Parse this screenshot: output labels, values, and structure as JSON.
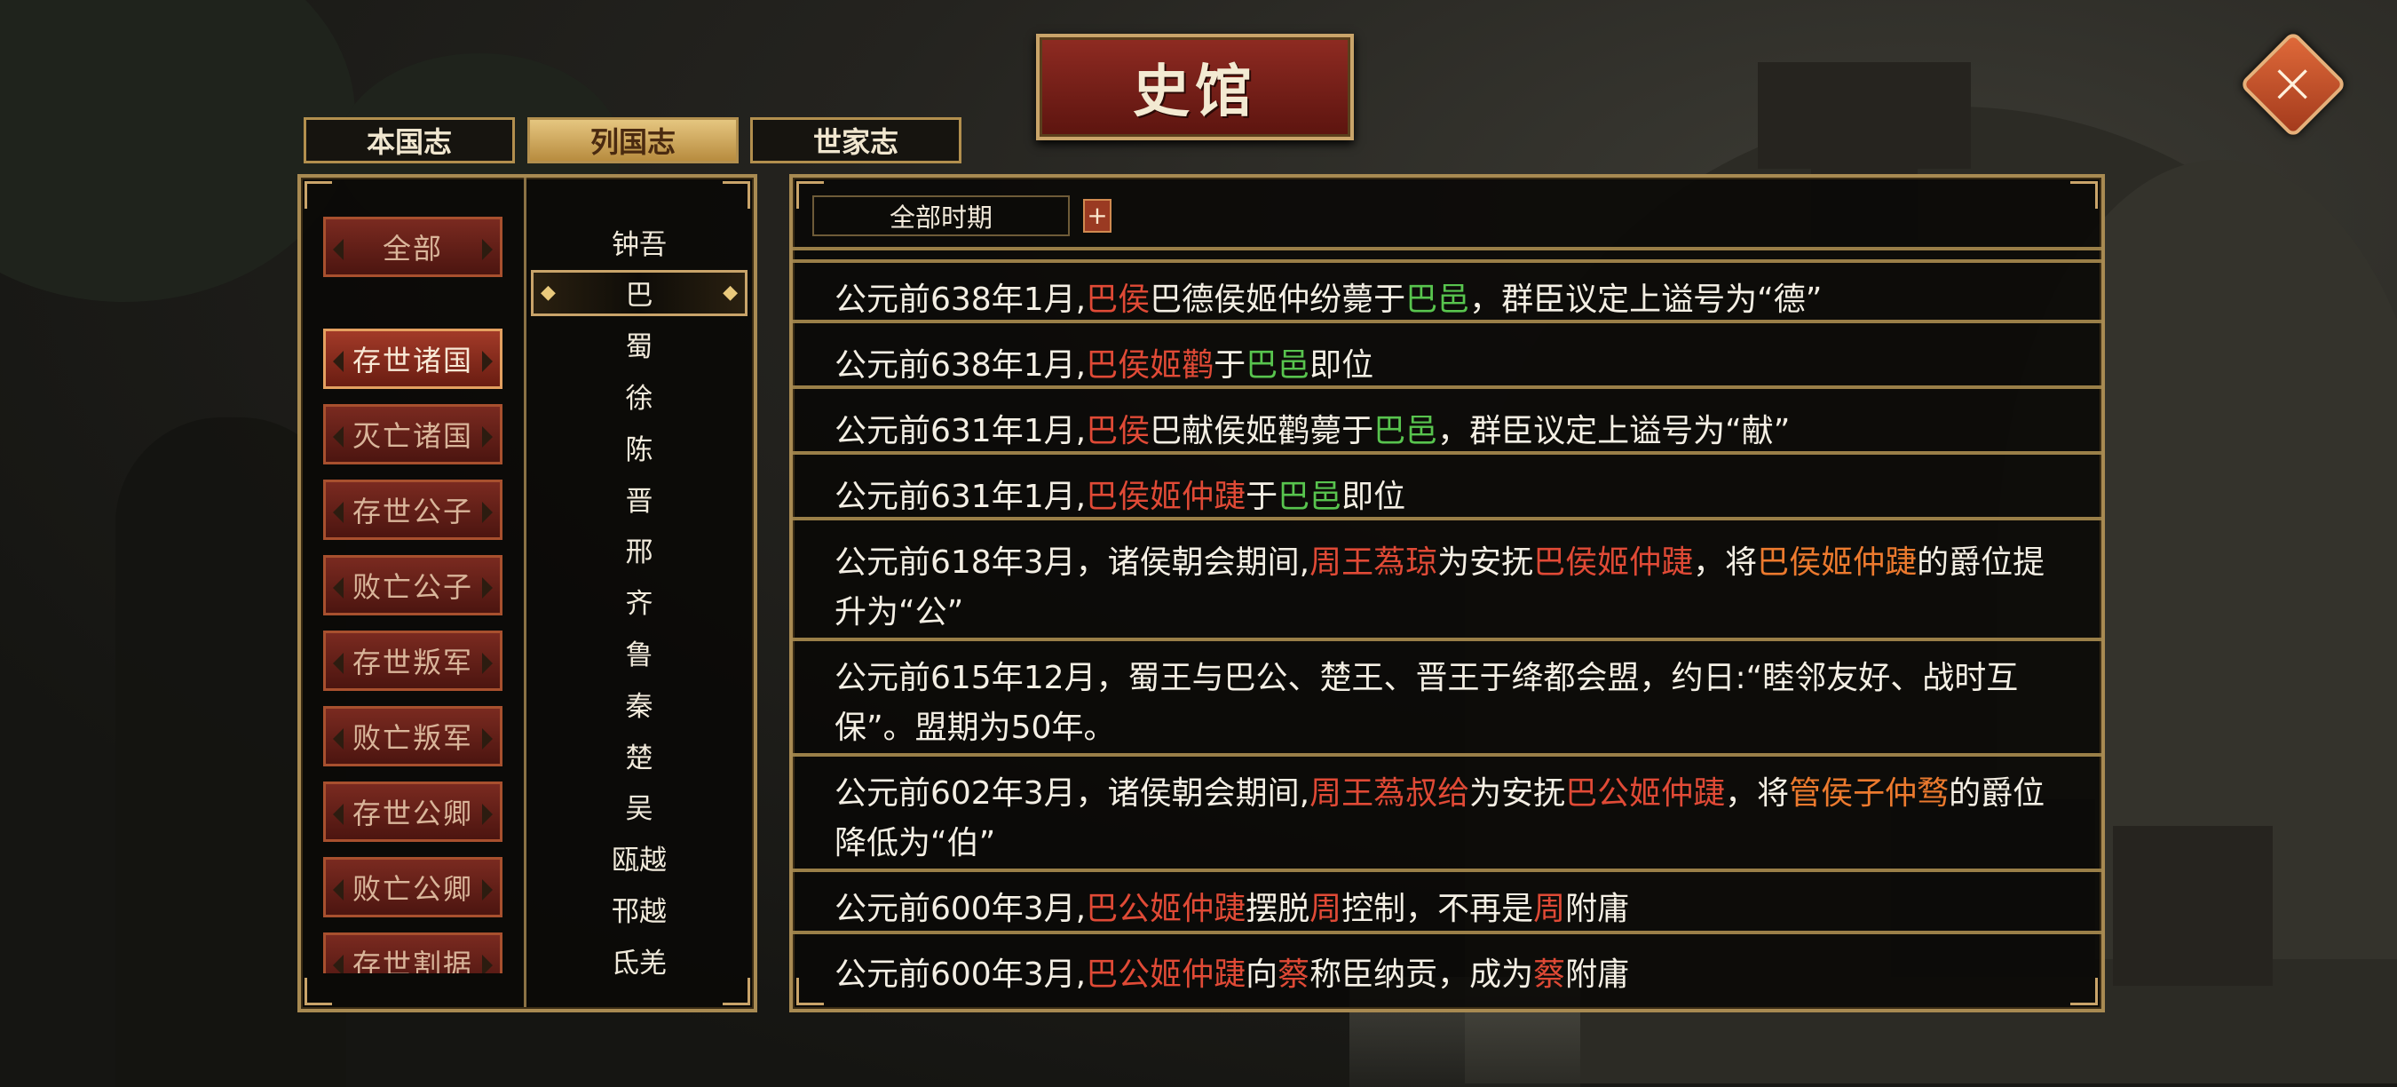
{
  "window": {
    "title": "史馆",
    "close_icon": "close-icon"
  },
  "tabs": [
    {
      "label": "本国志",
      "active": false
    },
    {
      "label": "列国志",
      "active": true
    },
    {
      "label": "世家志",
      "active": false
    }
  ],
  "categories": {
    "all_label": "全部",
    "items": [
      {
        "label": "存世诸国",
        "active": true
      },
      {
        "label": "灭亡诸国",
        "active": false
      },
      {
        "label": "存世公子",
        "active": false
      },
      {
        "label": "败亡公子",
        "active": false
      },
      {
        "label": "存世叛军",
        "active": false
      },
      {
        "label": "败亡叛军",
        "active": false
      },
      {
        "label": "存世公卿",
        "active": false
      },
      {
        "label": "败亡公卿",
        "active": false
      },
      {
        "label": "存世割据",
        "active": false
      }
    ]
  },
  "nations": {
    "selected": "巴",
    "items": [
      "钟吾",
      "巴",
      "蜀",
      "徐",
      "陈",
      "晋",
      "邢",
      "齐",
      "鲁",
      "秦",
      "楚",
      "吴",
      "瓯越",
      "邗越",
      "氐羌"
    ]
  },
  "filter": {
    "period": "全部时期",
    "add_label": "+"
  },
  "colors": {
    "red": "#e04a36",
    "green": "#58c44e",
    "orange": "#ec7a2e",
    "gold": "#c9a46a"
  },
  "entries": [
    {
      "parts": [
        {
          "t": "公元前638年1月,"
        },
        {
          "t": "巴侯",
          "c": "r"
        },
        {
          "t": "巴德侯姬仲纷薨于"
        },
        {
          "t": "巴邑",
          "c": "g"
        },
        {
          "t": "，群臣议定上谥号为“德”"
        }
      ]
    },
    {
      "parts": [
        {
          "t": "公元前638年1月,"
        },
        {
          "t": "巴侯姬鹳",
          "c": "r"
        },
        {
          "t": "于"
        },
        {
          "t": "巴邑",
          "c": "g"
        },
        {
          "t": "即位"
        }
      ]
    },
    {
      "parts": [
        {
          "t": "公元前631年1月,"
        },
        {
          "t": "巴侯",
          "c": "r"
        },
        {
          "t": "巴献侯姬鹳薨于"
        },
        {
          "t": "巴邑",
          "c": "g"
        },
        {
          "t": "，群臣议定上谥号为“献”"
        }
      ]
    },
    {
      "parts": [
        {
          "t": "公元前631年1月,"
        },
        {
          "t": "巴侯姬仲踕",
          "c": "r"
        },
        {
          "t": "于"
        },
        {
          "t": "巴邑",
          "c": "g"
        },
        {
          "t": "即位"
        }
      ]
    },
    {
      "parts": [
        {
          "t": "公元前618年3月，诸侯朝会期间,"
        },
        {
          "t": "周王蒍琼",
          "c": "r"
        },
        {
          "t": "为安抚"
        },
        {
          "t": "巴侯姬仲踕",
          "c": "r"
        },
        {
          "t": "，将"
        },
        {
          "t": "巴侯姬仲踕",
          "c": "o"
        },
        {
          "t": "的爵位提升为“公”"
        }
      ]
    },
    {
      "parts": [
        {
          "t": "公元前615年12月，蜀王与巴公、楚王、晋王于绛都会盟，约日:“睦邻友好、战时互保”。盟期为50年。"
        }
      ]
    },
    {
      "parts": [
        {
          "t": "公元前602年3月，诸侯朝会期间,"
        },
        {
          "t": "周王蒍叔给",
          "c": "r"
        },
        {
          "t": "为安抚"
        },
        {
          "t": "巴公姬仲踕",
          "c": "r"
        },
        {
          "t": "，将"
        },
        {
          "t": "管侯子仲骛",
          "c": "o"
        },
        {
          "t": "的爵位降低为“伯”"
        }
      ]
    },
    {
      "parts": [
        {
          "t": "公元前600年3月,"
        },
        {
          "t": "巴公姬仲踕",
          "c": "r"
        },
        {
          "t": "摆脱"
        },
        {
          "t": "周",
          "c": "r"
        },
        {
          "t": "控制，不再是"
        },
        {
          "t": "周",
          "c": "r"
        },
        {
          "t": "附庸"
        }
      ]
    },
    {
      "parts": [
        {
          "t": "公元前600年3月,"
        },
        {
          "t": "巴公姬仲踕",
          "c": "r"
        },
        {
          "t": "向"
        },
        {
          "t": "蔡",
          "c": "r"
        },
        {
          "t": "称臣纳贡，成为"
        },
        {
          "t": "蔡",
          "c": "r"
        },
        {
          "t": "附庸"
        }
      ]
    }
  ]
}
